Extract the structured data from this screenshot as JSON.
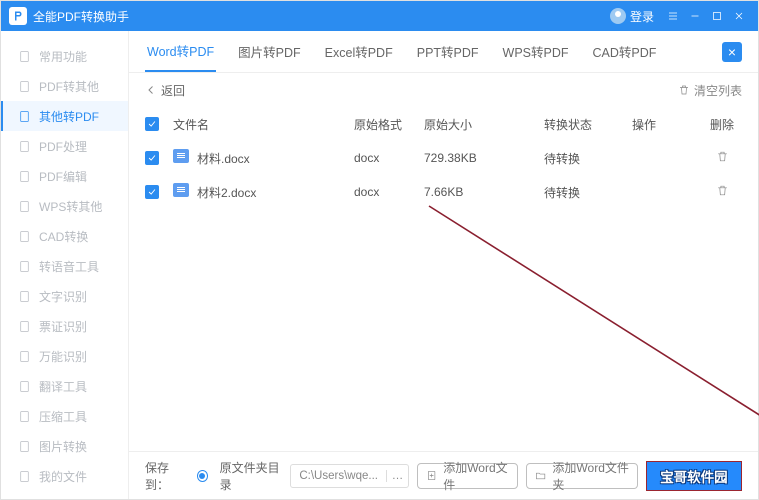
{
  "titlebar": {
    "title": "全能PDF转换助手",
    "login": "登录"
  },
  "sidebar": {
    "items": [
      {
        "label": "常用功能"
      },
      {
        "label": "PDF转其他"
      },
      {
        "label": "其他转PDF"
      },
      {
        "label": "PDF处理"
      },
      {
        "label": "PDF编辑"
      },
      {
        "label": "WPS转其他"
      },
      {
        "label": "CAD转换"
      },
      {
        "label": "转语音工具"
      },
      {
        "label": "文字识别"
      },
      {
        "label": "票证识别"
      },
      {
        "label": "万能识别"
      },
      {
        "label": "翻译工具"
      },
      {
        "label": "压缩工具"
      },
      {
        "label": "图片转换"
      },
      {
        "label": "我的文件"
      }
    ],
    "activeIndex": 2
  },
  "tabs": {
    "items": [
      "Word转PDF",
      "图片转PDF",
      "Excel转PDF",
      "PPT转PDF",
      "WPS转PDF",
      "CAD转PDF"
    ],
    "activeIndex": 0
  },
  "toolbar": {
    "back": "返回",
    "clear": "清空列表"
  },
  "table": {
    "headers": {
      "name": "文件名",
      "format": "原始格式",
      "size": "原始大小",
      "status": "转换状态",
      "op": "操作",
      "del": "删除"
    },
    "rows": [
      {
        "name": "材料.docx",
        "format": "docx",
        "size": "729.38KB",
        "status": "待转换"
      },
      {
        "name": "材料2.docx",
        "format": "docx",
        "size": "7.66KB",
        "status": "待转换"
      }
    ]
  },
  "footer": {
    "saveTo": "保存到：",
    "radioLabel": "原文件夹目录",
    "path": "C:\\Users\\wqe...",
    "addFile": "添加Word文件",
    "addFolder": "添加Word文件夹",
    "convert": "宝哥软件园"
  }
}
